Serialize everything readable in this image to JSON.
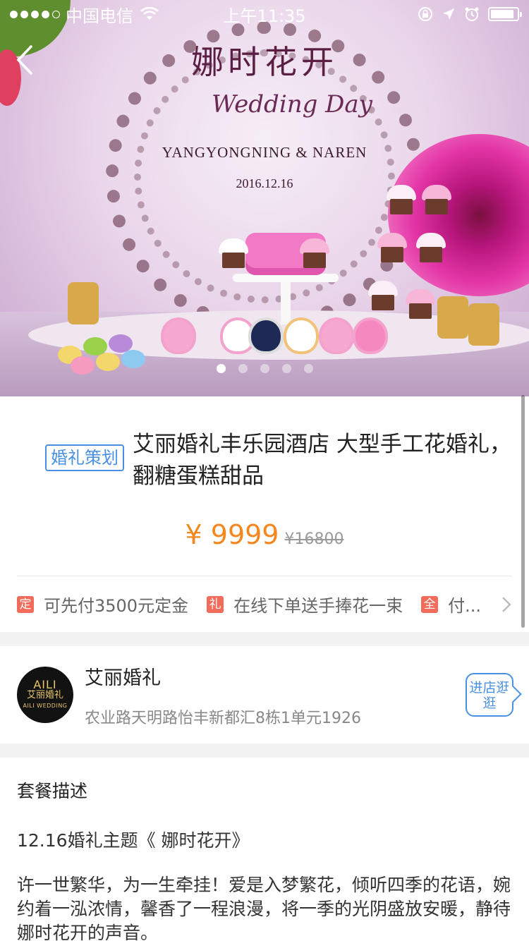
{
  "status_bar": {
    "carrier": "中国电信",
    "time": "上午11:35",
    "battery_level": 0.9
  },
  "hero": {
    "title_cn": "娜时花开",
    "script": "Wedding Day",
    "names": "YANGYONGNING & NAREN",
    "date": "2016.12.16",
    "slide_count": 5,
    "active_slide": 1
  },
  "product": {
    "tag": "婚礼策划",
    "title": "艾丽婚礼丰乐园酒店 大型手工花婚礼，翻糖蛋糕甜品",
    "price": "¥ 9999",
    "original_price": "¥16800",
    "promotions": [
      {
        "badge": "定",
        "text": "可先付3500元定金"
      },
      {
        "badge": "礼",
        "text": "在线下单送手捧花一束"
      },
      {
        "badge": "全",
        "text": "付..."
      }
    ]
  },
  "shop": {
    "logo_mark": "AILI",
    "logo_cn": "艾丽婚礼",
    "logo_en": "AILI WEDDING",
    "name": "艾丽婚礼",
    "address": "农业路天明路怡丰新都汇8栋1单元1926",
    "enter_button": "进店逛逛"
  },
  "description": {
    "heading": "套餐描述",
    "theme": "12.16婚礼主题《 娜时花开》",
    "body": "许一世繁华，为一生牵挂！爱是入梦繁花，倾听四季的花语，婉约着一泓浓情，馨香了一程浪漫，将一季的光阴盛放安暖，静待娜时花开的声音。"
  },
  "colors": {
    "accent_blue": "#4a90e2",
    "price_orange": "#f5871f",
    "promo_red": "#f26b5b"
  }
}
